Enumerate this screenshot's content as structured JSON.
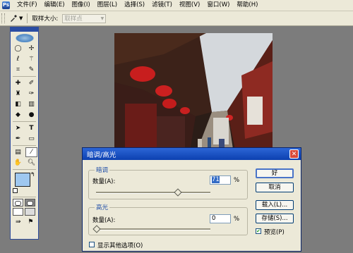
{
  "menubar": {
    "items": [
      "文件(F)",
      "编辑(E)",
      "图像(I)",
      "图层(L)",
      "选择(S)",
      "滤镜(T)",
      "视图(V)",
      "窗口(W)",
      "帮助(H)"
    ]
  },
  "options_bar": {
    "sample_size_label": "取样大小:",
    "sample_size_value": "取样点"
  },
  "colors": {
    "foreground": "#9fc8f0",
    "background": "#ffffff",
    "accent": "#0c40b0"
  },
  "dialog": {
    "title": "暗调/高光",
    "shadows": {
      "legend": "暗调",
      "amount_label": "数量(A):",
      "amount_value": "71",
      "amount": 71,
      "unit": "%"
    },
    "highlights": {
      "legend": "高光",
      "amount_label": "数量(A):",
      "amount_value": "0",
      "amount": 0,
      "unit": "%"
    },
    "show_more": {
      "label": "显示其他选项(O)",
      "checked": false
    },
    "buttons": {
      "ok": "好",
      "cancel": "取消",
      "load": "载入(L)...",
      "save": "存储(S)..."
    },
    "preview": {
      "label": "预览(P)",
      "checked": true
    }
  }
}
